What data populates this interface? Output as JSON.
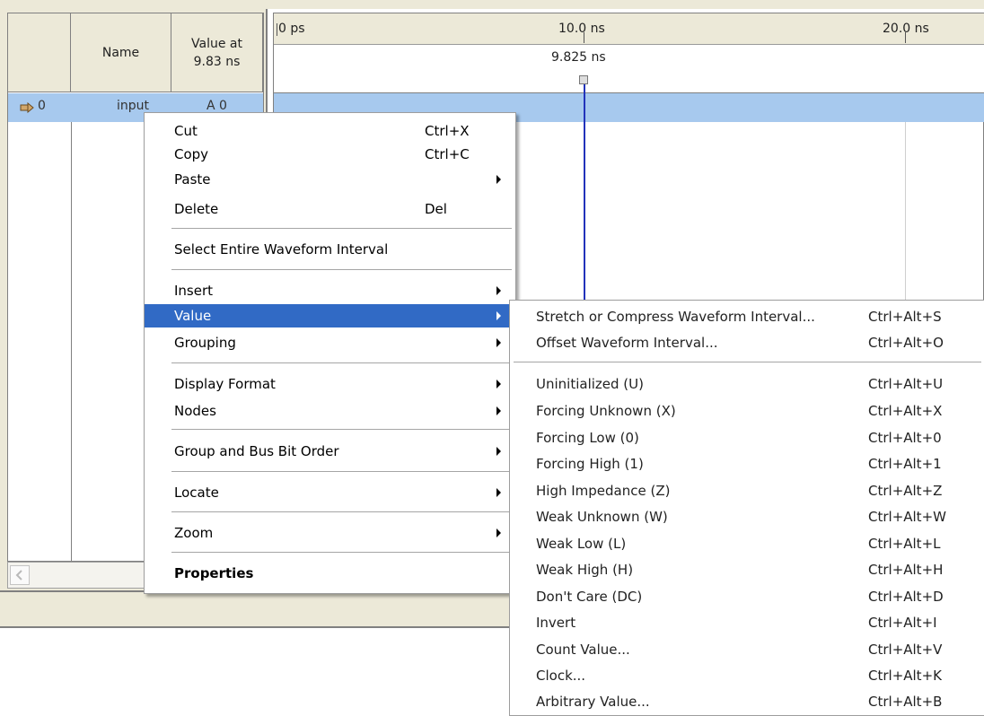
{
  "columns": {
    "blank": "",
    "name": "Name",
    "value": "Value at\n9.83 ns"
  },
  "row": {
    "index": "0",
    "name": "input",
    "value": "A 0"
  },
  "ruler": {
    "t0": "0 ps",
    "t10": "10.0 ns",
    "t20": "20.0 ns",
    "cursor": "9.825 ns"
  },
  "menu": {
    "cut": "Cut",
    "cut_sc": "Ctrl+X",
    "copy": "Copy",
    "copy_sc": "Ctrl+C",
    "paste": "Paste",
    "delete": "Delete",
    "delete_sc": "Del",
    "select_interval": "Select Entire Waveform Interval",
    "insert": "Insert",
    "value": "Value",
    "grouping": "Grouping",
    "display_format": "Display Format",
    "nodes": "Nodes",
    "bit_order": "Group and Bus Bit Order",
    "locate": "Locate",
    "zoom": "Zoom",
    "properties": "Properties"
  },
  "submenu": {
    "items": [
      {
        "label": "Stretch or Compress Waveform Interval...",
        "sc": "Ctrl+Alt+S"
      },
      {
        "label": "Offset Waveform Interval...",
        "sc": "Ctrl+Alt+O"
      },
      {
        "label": "Uninitialized (U)",
        "sc": "Ctrl+Alt+U"
      },
      {
        "label": "Forcing Unknown (X)",
        "sc": "Ctrl+Alt+X"
      },
      {
        "label": "Forcing Low (0)",
        "sc": "Ctrl+Alt+0"
      },
      {
        "label": "Forcing High (1)",
        "sc": "Ctrl+Alt+1"
      },
      {
        "label": "High Impedance (Z)",
        "sc": "Ctrl+Alt+Z"
      },
      {
        "label": "Weak Unknown (W)",
        "sc": "Ctrl+Alt+W"
      },
      {
        "label": "Weak Low (L)",
        "sc": "Ctrl+Alt+L"
      },
      {
        "label": "Weak High (H)",
        "sc": "Ctrl+Alt+H"
      },
      {
        "label": "Don't Care (DC)",
        "sc": "Ctrl+Alt+D"
      },
      {
        "label": "Invert",
        "sc": "Ctrl+Alt+I"
      },
      {
        "label": "Count Value...",
        "sc": "Ctrl+Alt+V"
      },
      {
        "label": "Clock...",
        "sc": "Ctrl+Alt+K"
      },
      {
        "label": "Arbitrary Value...",
        "sc": "Ctrl+Alt+B"
      }
    ]
  },
  "colors": {
    "highlight": "#316ac5",
    "selected_row": "#a7c9ee",
    "cursor": "#2233bb",
    "chrome": "#ece9d8"
  },
  "icons": {
    "row_node": "input-pin-icon",
    "scroll_left": "chevron-left-icon",
    "submenu": "chevron-right-icon"
  }
}
